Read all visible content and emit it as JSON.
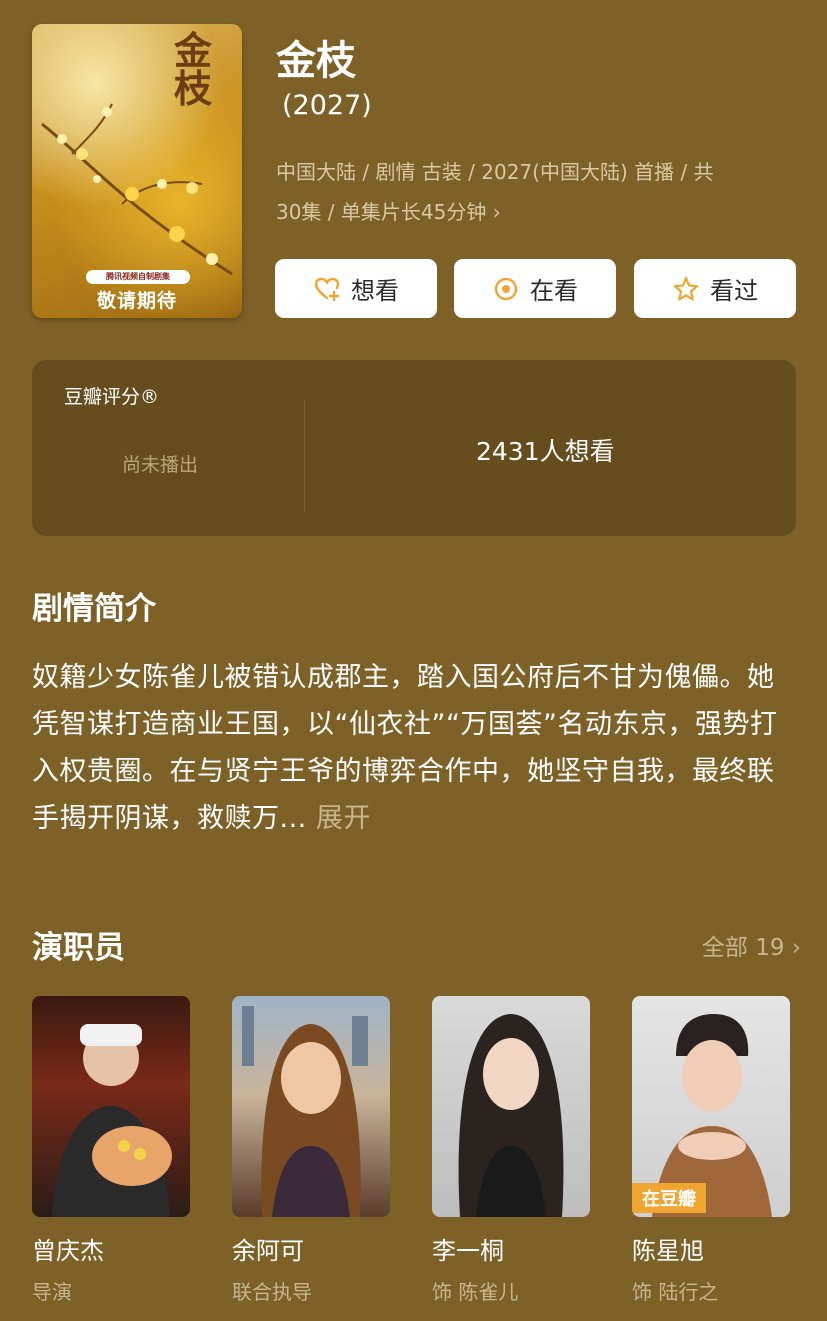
{
  "poster": {
    "title_art": "金枝",
    "badge": "腾讯视频自制剧集",
    "cta": "敬请期待"
  },
  "show": {
    "title": "金枝",
    "year": "(2027)",
    "meta_line1": "中国大陆 / 剧情 古装 / 2027(中国大陆) 首播 / 共",
    "meta_line2": "30集 / 单集片长45分钟",
    "meta_chevron": "›"
  },
  "actions": [
    {
      "label": "想看",
      "icon": "heart-plus-icon"
    },
    {
      "label": "在看",
      "icon": "target-icon"
    },
    {
      "label": "看过",
      "icon": "star-icon"
    }
  ],
  "rating": {
    "label": "豆瓣评分®",
    "status": "尚未播出",
    "want_count": "2431人想看"
  },
  "synopsis": {
    "heading": "剧情简介",
    "text": "奴籍少女陈雀儿被错认成郡主，踏入国公府后不甘为傀儡。她凭智谋打造商业王国，以“仙衣社”“万国荟”名动东京，强势打入权贵圈。在与贤宁王爷的博弈合作中，她坚守自我，最终联手揭开阴谋，救赎万...",
    "expand": "展开"
  },
  "cast": {
    "heading": "演职员",
    "all_link": "全部 19 ›",
    "members": [
      {
        "name": "曾庆杰",
        "role": "导演"
      },
      {
        "name": "余阿可",
        "role": "联合执导"
      },
      {
        "name": "李一桐",
        "role": "饰 陈雀儿"
      },
      {
        "name": "陈星旭",
        "role": "饰 陆行之",
        "tag": "在豆瓣"
      }
    ]
  },
  "colors": {
    "background": "#7d6126",
    "card": "#654d1d",
    "muted_text": "#c7b58d",
    "accent": "#f0a531"
  }
}
